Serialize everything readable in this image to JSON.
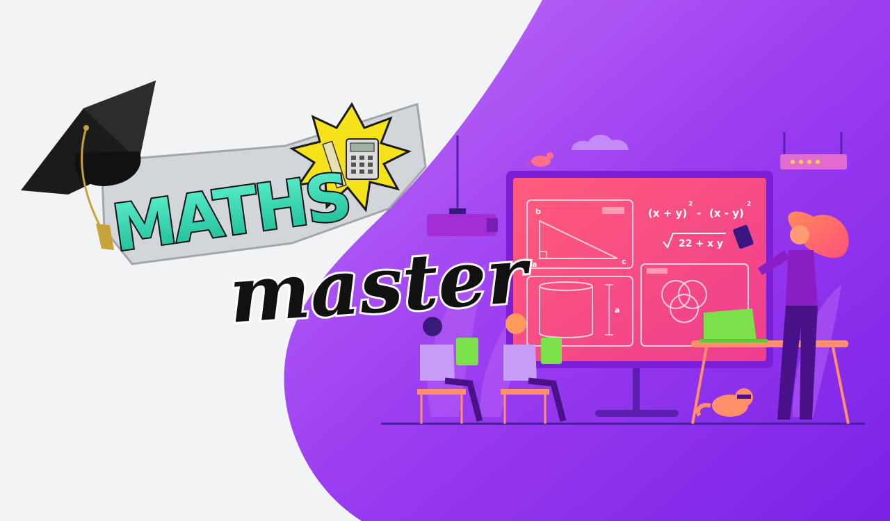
{
  "logo": {
    "word1": "MATHS",
    "word2": "master"
  },
  "board": {
    "equation_line1": "(x + y)",
    "equation_sup1": "2",
    "equation_minus": "-",
    "equation_line1b": "(x - y)",
    "equation_sup2": "2",
    "equation_root": "22 + x y",
    "triangle_label_b": "b",
    "triangle_label_a": "a",
    "triangle_label_c": "c",
    "cylinder_label_a": "a"
  },
  "colors": {
    "background": "#f1f3f5",
    "purple_blob": "#9b3df0",
    "board_pink": "#f7507a",
    "logo_teal": "#2de0b8",
    "burst_yellow": "#f6e21a",
    "laptop_green": "#7be04a"
  }
}
